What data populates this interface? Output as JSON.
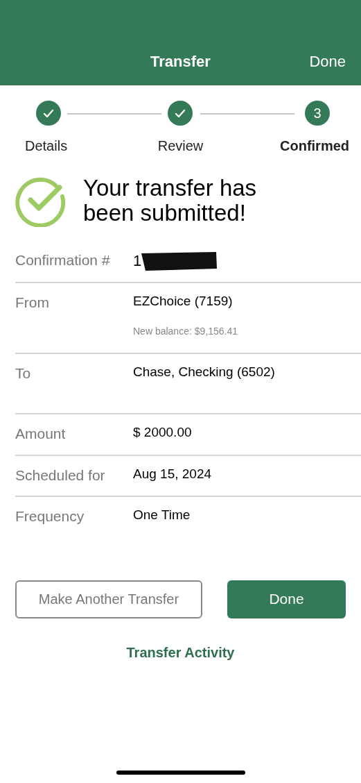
{
  "header": {
    "title": "Transfer",
    "action": "Done"
  },
  "steps": [
    {
      "label": "Details",
      "done": true,
      "selected": false
    },
    {
      "label": "Review",
      "done": true,
      "selected": false
    },
    {
      "label": "Confirmed",
      "done": false,
      "number": "3",
      "selected": true
    }
  ],
  "message": "Your transfer has been submitted!",
  "details": [
    {
      "label": "Confirmation #",
      "value": "1",
      "redacted": true
    },
    {
      "label": "From",
      "value": "EZChoice (7159)",
      "note": "New balance:  $9,156.41"
    },
    {
      "label": "To",
      "value": "Chase, Checking (6502)",
      "tall": true
    },
    {
      "label": "Amount",
      "value": "$ 2000.00"
    },
    {
      "label": "Scheduled for",
      "value": "Aug 15, 2024"
    },
    {
      "label": "Frequency",
      "value": "One Time"
    }
  ],
  "buttons": {
    "secondary": "Make Another Transfer",
    "primary": "Done"
  },
  "link": "Transfer Activity"
}
